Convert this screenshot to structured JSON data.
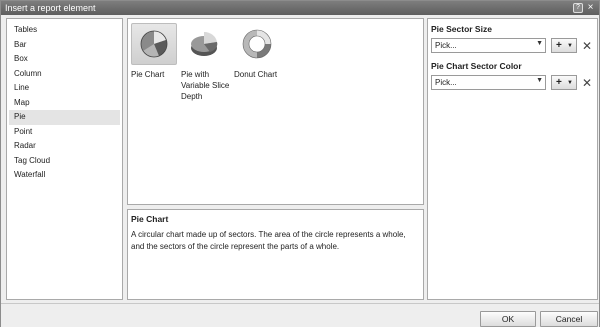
{
  "dialog": {
    "title": "Insert a report element",
    "help": "?",
    "close": "×"
  },
  "categories": [
    {
      "label": "Tables"
    },
    {
      "label": "Bar"
    },
    {
      "label": "Box"
    },
    {
      "label": "Column"
    },
    {
      "label": "Line"
    },
    {
      "label": "Map"
    },
    {
      "label": "Pie"
    },
    {
      "label": "Point"
    },
    {
      "label": "Radar"
    },
    {
      "label": "Tag Cloud"
    },
    {
      "label": "Waterfall"
    }
  ],
  "chart_types": [
    {
      "label": "Pie Chart",
      "icon": "pie-chart-icon"
    },
    {
      "label": "Pie with Variable Slice Depth",
      "icon": "pie-variable-depth-icon"
    },
    {
      "label": "Donut Chart",
      "icon": "donut-chart-icon"
    }
  ],
  "description": {
    "title": "Pie Chart",
    "text": "A circular chart made up of sectors. The area of the circle represents a whole, and the sectors of the circle represent the parts of a whole."
  },
  "properties": {
    "sector_size": {
      "label": "Pie Sector Size",
      "value": "Pick..."
    },
    "sector_color": {
      "label": "Pie Chart Sector Color",
      "value": "Pick..."
    },
    "plus_label": "+",
    "remove_label": "✕"
  },
  "footer": {
    "ok_label": "OK",
    "cancel_label": "Cancel"
  }
}
